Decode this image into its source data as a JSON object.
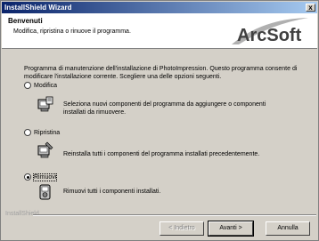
{
  "window": {
    "title": "InstallShield Wizard",
    "close_glyph": "x"
  },
  "header": {
    "title": "Benvenuti",
    "subtitle": "Modifica, ripristina o rinuove il programma.",
    "logo_text": "ArcSoft"
  },
  "intro": "Programma di manutenzione dell'installazione di PhotoImpression. Questo programma consente di modificare l'installazione corrente. Scegliere una delle opzioni seguenti.",
  "options": [
    {
      "label": "Modifica",
      "description": "Seleziona nuovi componenti del programma da aggiungere o componenti installati da rimuovere.",
      "checked": false,
      "icon": "modify-icon"
    },
    {
      "label": "Ripristina",
      "description": "Reinstalla tutti i componenti del programma installati precedentemente.",
      "checked": false,
      "icon": "repair-icon"
    },
    {
      "label": "Rimuovi",
      "description": "Rimuovi tutti i componenti installati.",
      "checked": true,
      "icon": "remove-icon"
    }
  ],
  "footer": {
    "brand": "InstallShield"
  },
  "buttons": {
    "back": "< Indietro",
    "next": "Avanti >",
    "cancel": "Annulla"
  },
  "colors": {
    "dialog_bg": "#d4d0c8",
    "title_bar_start": "#0a246a",
    "title_bar_end": "#a6caf0"
  }
}
